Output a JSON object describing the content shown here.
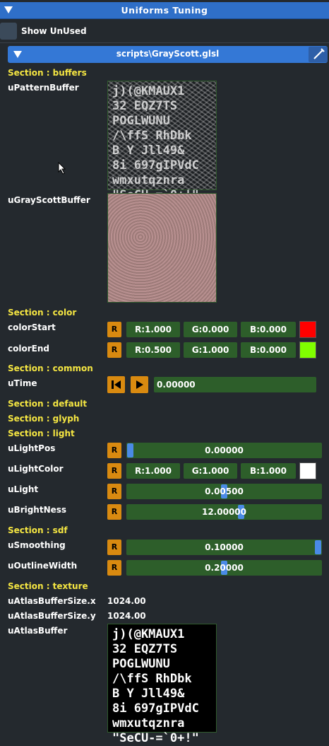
{
  "header": {
    "title": "Uniforms Tuning"
  },
  "show_unused": {
    "label": "Show UnUsed"
  },
  "file": {
    "name": "scripts\\GrayScott.glsl"
  },
  "sections": {
    "buffers": "Section : buffers",
    "color": "Section : color",
    "common": "Section : common",
    "default": "Section : default",
    "glyph": "Section : glyph",
    "light": "Section : light",
    "sdf": "Section : sdf",
    "texture": "Section : texture"
  },
  "uniforms": {
    "uPatternBuffer": {
      "label": "uPatternBuffer"
    },
    "uGrayScottBuffer": {
      "label": "uGrayScottBuffer"
    },
    "colorStart": {
      "label": "colorStart",
      "r": "R:1.000",
      "g": "G:0.000",
      "b": "B:0.000",
      "swatch": "#ff0000"
    },
    "colorEnd": {
      "label": "colorEnd",
      "r": "R:0.500",
      "g": "G:1.000",
      "b": "B:0.000",
      "swatch": "#80ff00"
    },
    "uTime": {
      "label": "uTime",
      "value": "0.00000"
    },
    "uLightPos": {
      "label": "uLightPos",
      "value": "0.00000",
      "fraction": 0.0
    },
    "uLightColor": {
      "label": "uLightColor",
      "r": "R:1.000",
      "g": "G:1.000",
      "b": "B:1.000",
      "swatch": "#ffffff"
    },
    "uLight": {
      "label": "uLight",
      "value": "0.00500",
      "fraction": 0.5
    },
    "uBrightNess": {
      "label": "uBrightNess",
      "value": "12.00000",
      "fraction": 0.59
    },
    "uSmoothing": {
      "label": "uSmoothing",
      "value": "0.10000",
      "fraction": 1.0
    },
    "uOutlineWidth": {
      "label": "uOutlineWidth",
      "value": "0.20000",
      "fraction": 0.5
    },
    "uAtlasBufferSizeX": {
      "label": "uAtlasBufferSize.x",
      "value": "1024.00"
    },
    "uAtlasBufferSizeY": {
      "label": "uAtlasBufferSize.y",
      "value": "1024.00"
    },
    "uAtlasBuffer": {
      "label": "uAtlasBuffer"
    }
  },
  "reset_label": "R",
  "atlas_glyphs": "j)(@KMAUX1\n32 EQZ7TS\nPOGLWUNU\n/\\ffS RhDbk\nB Y Jll49&\n8i 697gIPVdC\nwmxutqznra\n\"SeCU-=`0+!\"",
  "colors": {
    "accent": "#2f6fc8",
    "section": "#f5e642",
    "field": "#2d5e2a",
    "reset": "#d98a10"
  }
}
